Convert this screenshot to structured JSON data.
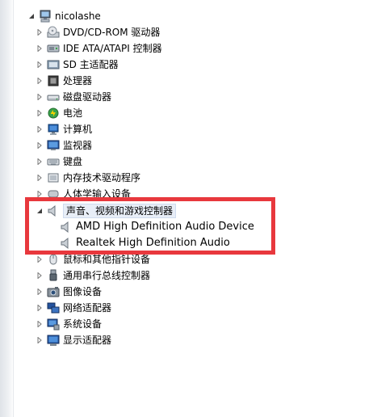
{
  "tree": {
    "root": {
      "label": "nicolashe",
      "icon": "computer-icon",
      "expanded": true
    },
    "categories": [
      {
        "label": "DVD/CD-ROM 驱动器",
        "icon": "dvd-drive-icon"
      },
      {
        "label": "IDE ATA/ATAPI 控制器",
        "icon": "ide-controller-icon"
      },
      {
        "label": "SD 主适配器",
        "icon": "sd-adapter-icon"
      },
      {
        "label": "处理器",
        "icon": "processor-icon"
      },
      {
        "label": "磁盘驱动器",
        "icon": "disk-drive-icon"
      },
      {
        "label": "电池",
        "icon": "battery-icon"
      },
      {
        "label": "计算机",
        "icon": "computer-monitor-icon"
      },
      {
        "label": "监视器",
        "icon": "monitor-icon"
      },
      {
        "label": "键盘",
        "icon": "keyboard-icon"
      },
      {
        "label": "内存技术驱动程序",
        "icon": "memory-tech-icon"
      },
      {
        "label": "人体学输入设备",
        "icon": "hid-icon"
      }
    ],
    "audio_category": {
      "label": "声音、视频和游戏控制器",
      "icon": "speaker-icon",
      "expanded": true,
      "children": [
        {
          "label": "AMD High Definition Audio Device",
          "icon": "speaker-icon"
        },
        {
          "label": "Realtek High Definition Audio",
          "icon": "speaker-icon"
        }
      ]
    },
    "after_categories": [
      {
        "label": "鼠标和其他指针设备",
        "icon": "mouse-icon"
      },
      {
        "label": "通用串行总线控制器",
        "icon": "usb-icon"
      },
      {
        "label": "图像设备",
        "icon": "camera-icon"
      },
      {
        "label": "网络适配器",
        "icon": "network-adapter-icon"
      },
      {
        "label": "系统设备",
        "icon": "system-device-icon"
      },
      {
        "label": "显示适配器",
        "icon": "display-adapter-icon"
      }
    ]
  },
  "colors": {
    "annotation_box": "#e8383d",
    "selection_bg": "#e8eef7"
  }
}
